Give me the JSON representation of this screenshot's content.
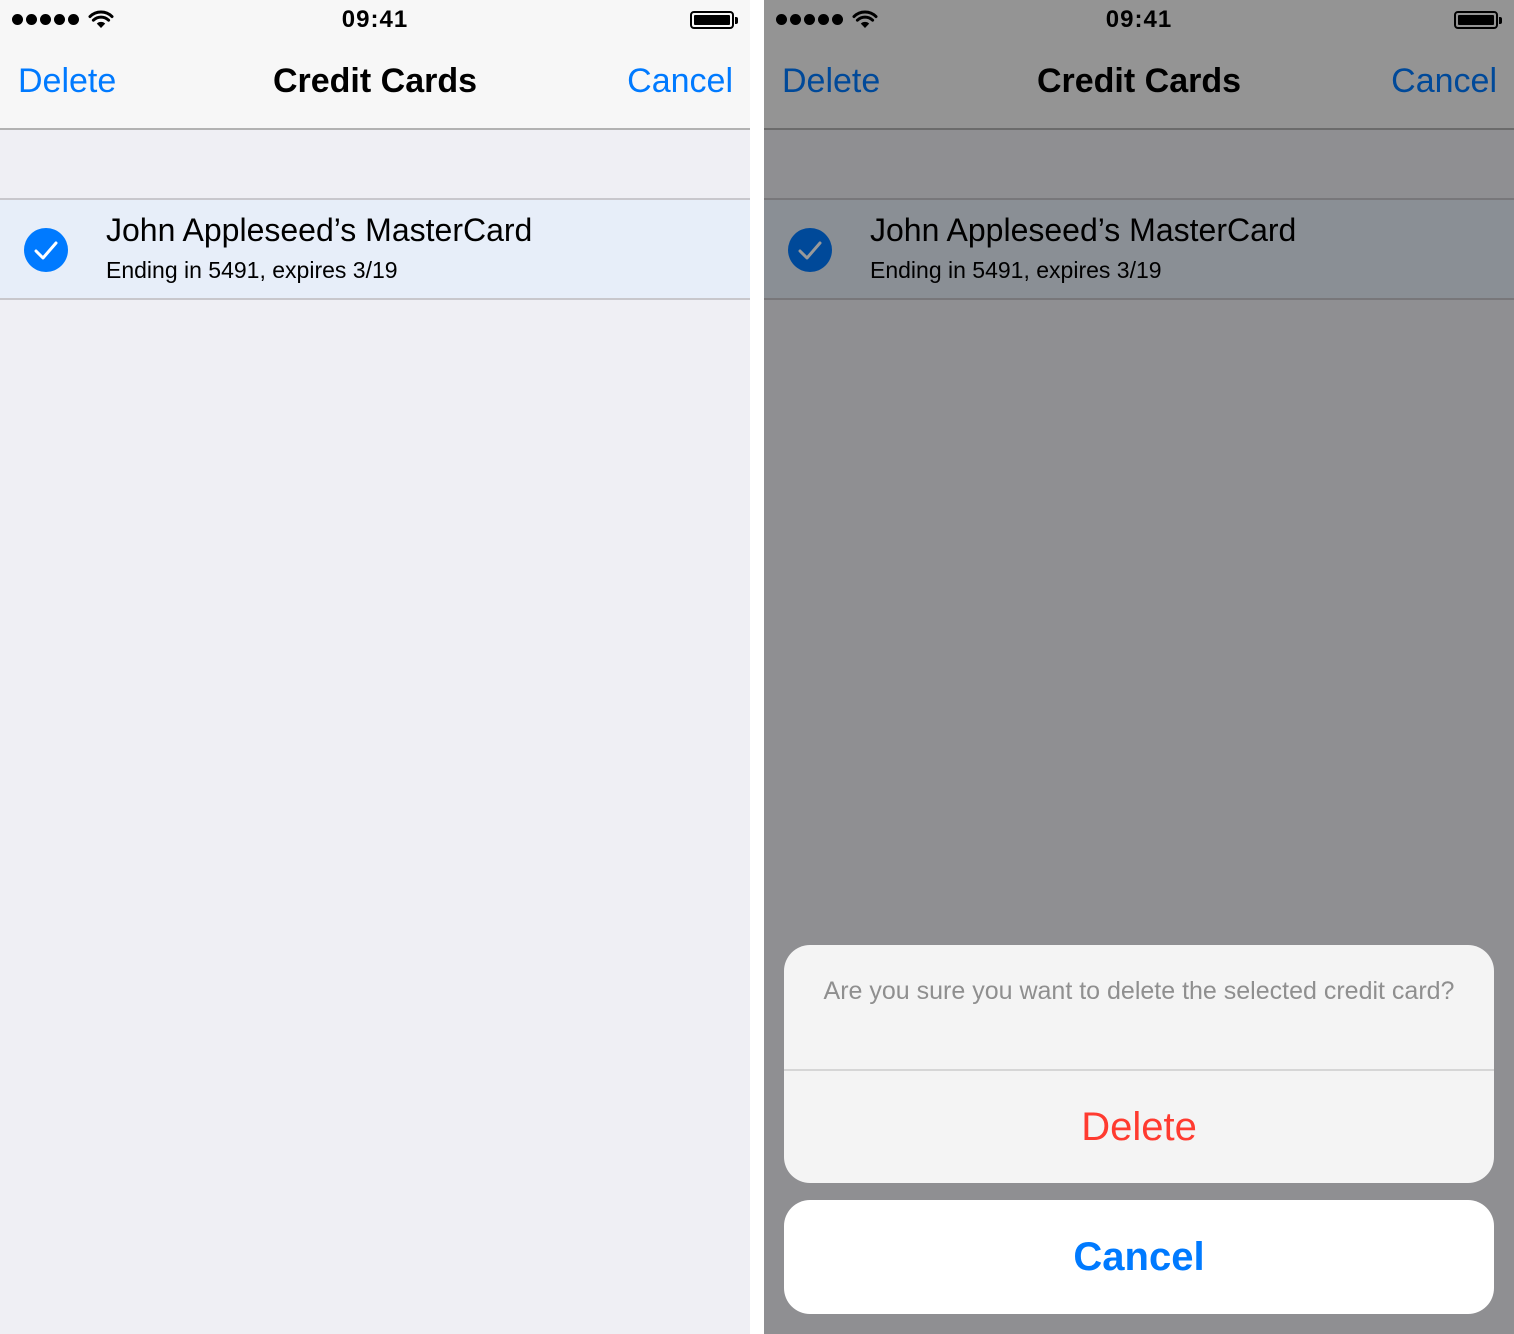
{
  "status_bar": {
    "time": "09:41"
  },
  "nav": {
    "left": "Delete",
    "title": "Credit Cards",
    "right": "Cancel"
  },
  "card": {
    "name": "John  Appleseed’s MasterCard",
    "detail": "Ending in 5491, expires 3/19"
  },
  "action_sheet": {
    "message": "Are you sure you want to delete the selected credit card?",
    "delete_label": "Delete",
    "cancel_label": "Cancel"
  },
  "colors": {
    "tint": "#007aff",
    "destructive": "#ff3b30",
    "background": "#efeff4",
    "selected_row": "#e7eef9"
  },
  "icons": {
    "signal": "signal-dots-icon",
    "wifi": "wifi-icon",
    "battery": "battery-icon",
    "checkmark": "checkmark-circle-icon"
  }
}
